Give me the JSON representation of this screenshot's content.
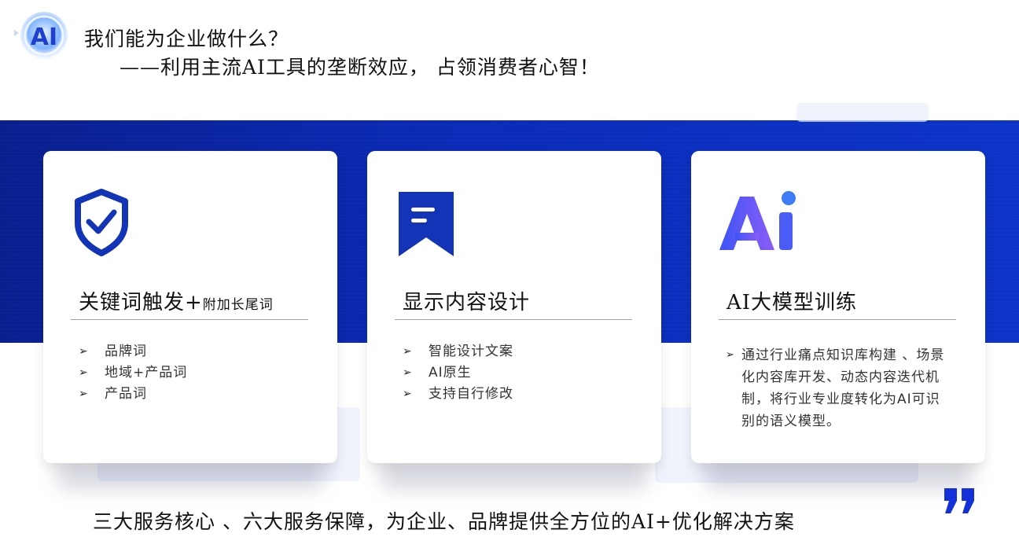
{
  "header": {
    "logo_text": "AI",
    "title": "我们能为企业做什么？",
    "subtitle": "——利用主流AI工具的垄断效应， 占领消费者心智！"
  },
  "cards": [
    {
      "icon": "shield-check-icon",
      "heading": "关键词触发+",
      "heading_small": "附加长尾词",
      "items": [
        "品牌词",
        "地域+产品词",
        "产品词"
      ]
    },
    {
      "icon": "bookmark-icon",
      "heading": "显示内容设计",
      "items": [
        "智能设计文案",
        "AI原生",
        "支持自行修改"
      ]
    },
    {
      "icon": "ai-logo-icon",
      "heading": "AI大模型训练",
      "items": [
        "通过行业痛点知识库构建 、场景化内容库开发、动态内容迭代机制，将行业专业度转化为AI可识别的语义模型。"
      ]
    }
  ],
  "footer": {
    "text": "三大服务核心 、六大服务保障，为企业、品牌提供全方位的AI+优化解决方案"
  },
  "colors": {
    "band": "#0b2bb8",
    "icon_blue": "#1434b8",
    "ai_gradient_start": "#3d55f5",
    "ai_gradient_end": "#8b5cf6",
    "quote": "#1430d8"
  }
}
